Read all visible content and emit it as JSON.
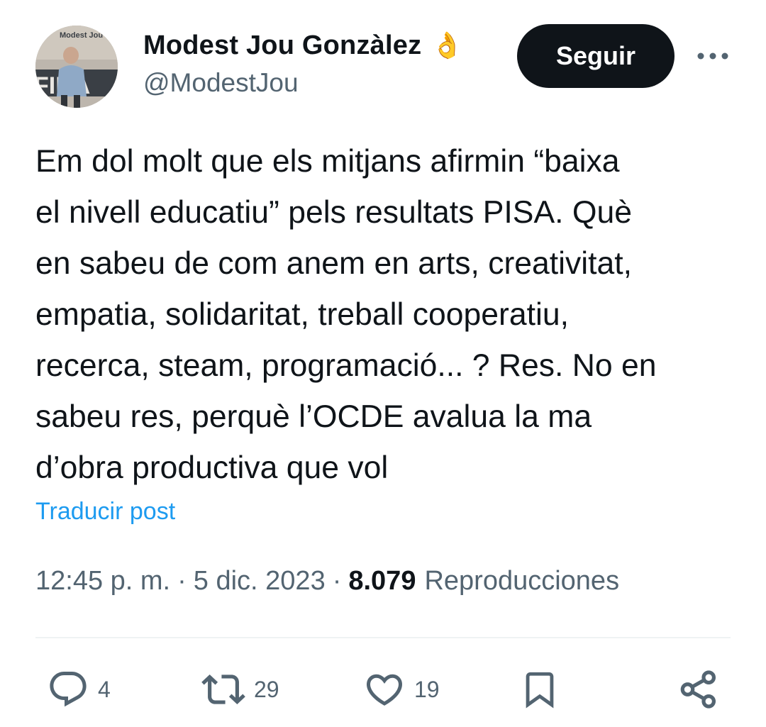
{
  "author": {
    "display_name": "Modest Jou Gonzàlez",
    "badge_emoji": "👌",
    "handle": "@ModestJou",
    "avatar_text": "Modest Jou",
    "avatar_banner_text": "FIDA"
  },
  "header": {
    "follow_label": "Seguir",
    "more_icon": "more-horizontal-icon"
  },
  "tweet": {
    "text": "Em dol molt que els mitjans afirmin “baixa\nel nivell educatiu” pels resultats PISA. Què\nen sabeu de com anem en arts, creativitat,\nempatia, solidaritat, treball cooperatiu,\nrecerca, steam, programació... ? Res. No en\nsabeu res, perquè l’OCDE avalua la ma\nd’obra productiva que vol",
    "translate_label": "Traducir post",
    "time": "12:45 p. m.",
    "separator": "·",
    "date": "5 dic. 2023",
    "views_count": "8.079",
    "views_label": "Reproducciones"
  },
  "actions": {
    "replies": {
      "icon": "reply-icon",
      "count": "4"
    },
    "retweets": {
      "icon": "retweet-icon",
      "count": "29"
    },
    "likes": {
      "icon": "heart-icon",
      "count": "19"
    },
    "bookmark": {
      "icon": "bookmark-icon"
    },
    "share": {
      "icon": "share-icon"
    }
  },
  "colors": {
    "text_primary": "#0f1419",
    "text_secondary": "#536471",
    "link": "#1d9bf0",
    "button_bg": "#0f1419",
    "button_text": "#ffffff"
  }
}
